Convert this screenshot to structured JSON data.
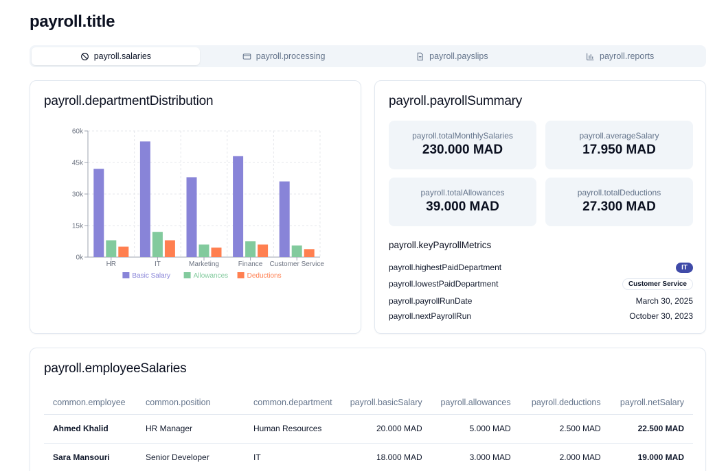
{
  "page": {
    "title": "payroll.title"
  },
  "tabs": [
    {
      "label": "payroll.salaries",
      "icon": "ban-icon",
      "active": true
    },
    {
      "label": "payroll.processing",
      "icon": "credit-card-icon",
      "active": false
    },
    {
      "label": "payroll.payslips",
      "icon": "file-text-icon",
      "active": false
    },
    {
      "label": "payroll.reports",
      "icon": "bar-chart-icon",
      "active": false
    }
  ],
  "department_card": {
    "title": "payroll.departmentDistribution"
  },
  "chart_data": {
    "type": "bar",
    "categories": [
      "HR",
      "IT",
      "Marketing",
      "Finance",
      "Customer Service"
    ],
    "series": [
      {
        "name": "Basic Salary",
        "values": [
          42000,
          55000,
          38000,
          48000,
          36000
        ],
        "color": "#8884d8"
      },
      {
        "name": "Allowances",
        "values": [
          8000,
          12000,
          6000,
          7500,
          5500
        ],
        "color": "#82ca9d"
      },
      {
        "name": "Deductions",
        "values": [
          5000,
          8000,
          4500,
          6000,
          3800
        ],
        "color": "#ff7f50"
      }
    ],
    "yticks": [
      "0k",
      "15k",
      "30k",
      "45k",
      "60k"
    ],
    "ylim": [
      0,
      60000
    ],
    "grid": true,
    "legend": "bottom"
  },
  "summary_card": {
    "title": "payroll.payrollSummary",
    "stats": [
      {
        "label": "payroll.totalMonthlySalaries",
        "value": "230.000 MAD"
      },
      {
        "label": "payroll.averageSalary",
        "value": "17.950 MAD"
      },
      {
        "label": "payroll.totalAllowances",
        "value": "39.000 MAD"
      },
      {
        "label": "payroll.totalDeductions",
        "value": "27.300 MAD"
      }
    ],
    "metrics_title": "payroll.keyPayrollMetrics",
    "metrics": [
      {
        "label": "payroll.highestPaidDepartment",
        "value": "IT"
      },
      {
        "label": "payroll.lowestPaidDepartment",
        "value": "Customer Service"
      },
      {
        "label": "payroll.payrollRunDate",
        "value": "March 30, 2025"
      },
      {
        "label": "payroll.nextPayrollRun",
        "value": "October 30, 2023"
      }
    ]
  },
  "employees_card": {
    "title": "payroll.employeeSalaries",
    "columns": [
      "common.employee",
      "common.position",
      "common.department",
      "payroll.basicSalary",
      "payroll.allowances",
      "payroll.deductions",
      "payroll.netSalary"
    ],
    "rows": [
      [
        "Ahmed Khalid",
        "HR Manager",
        "Human Resources",
        "20.000 MAD",
        "5.000 MAD",
        "2.500 MAD",
        "22.500 MAD"
      ],
      [
        "Sara Mansouri",
        "Senior Developer",
        "IT",
        "18.000 MAD",
        "3.000 MAD",
        "2.000 MAD",
        "19.000 MAD"
      ]
    ]
  }
}
